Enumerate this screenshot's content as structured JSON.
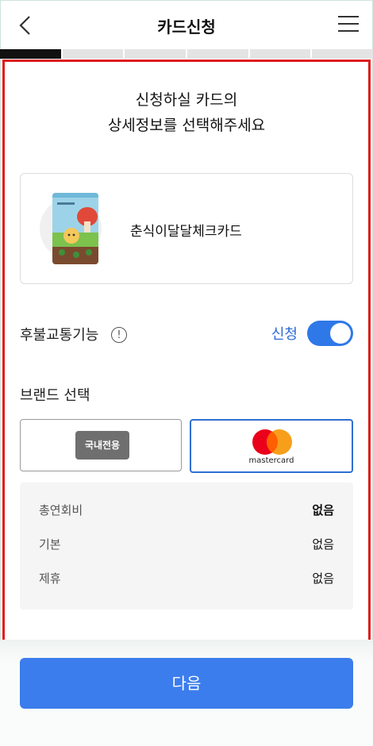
{
  "header": {
    "title": "카드신청",
    "back_icon": "chevron-left-icon",
    "menu_icon": "hamburger-menu-icon"
  },
  "progress": {
    "total_steps": 6,
    "current_step": 1
  },
  "heading": {
    "line1": "신청하실 카드의",
    "line2": "상세정보를 선택해주세요"
  },
  "card": {
    "name": "춘식이달달체크카드"
  },
  "transport": {
    "label": "후불교통기능",
    "info_icon": "info-icon",
    "status_text": "신청",
    "enabled": true
  },
  "brand": {
    "label": "브랜드 선택",
    "domestic_label": "국내전용",
    "mastercard_label": "mastercard",
    "selected": "mastercard"
  },
  "fees": {
    "rows": [
      {
        "label": "총연회비",
        "value": "없음"
      },
      {
        "label": "기본",
        "value": "없음"
      },
      {
        "label": "제휴",
        "value": "없음"
      }
    ]
  },
  "footer": {
    "next_label": "다음"
  },
  "colors": {
    "accent": "#3b7ded",
    "toggle": "#2f78e8",
    "highlight": "#e01b1b",
    "mc_red": "#eb001b",
    "mc_orange": "#f79e1b"
  }
}
